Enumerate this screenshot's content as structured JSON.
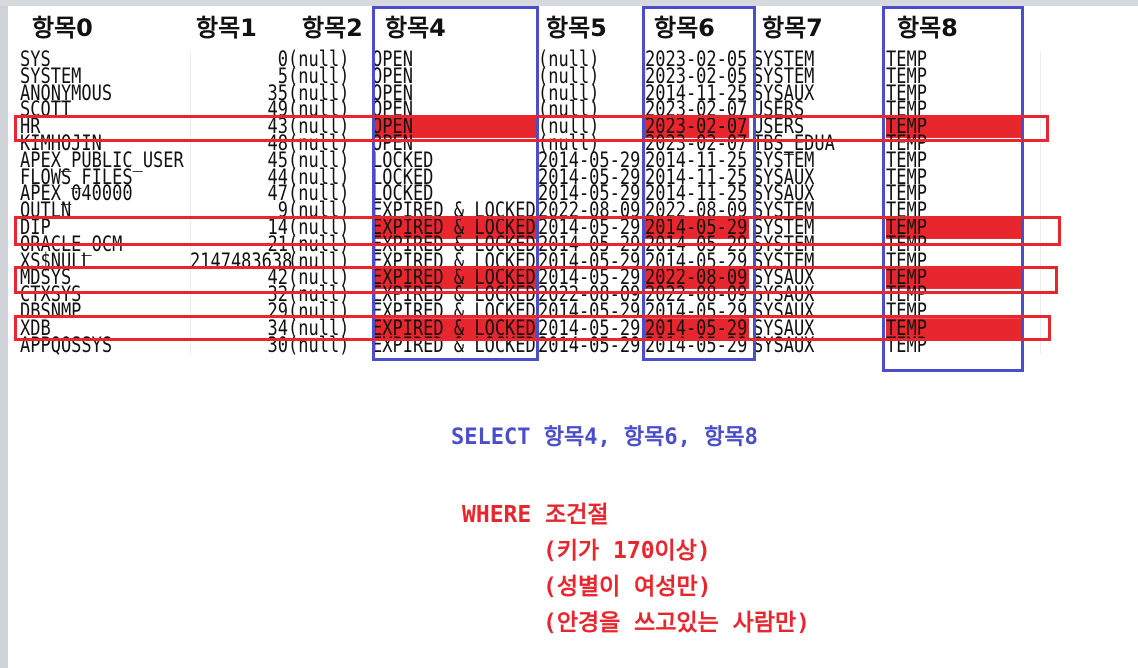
{
  "headers": [
    "항목0",
    "항목1",
    "항목2",
    "항목4",
    "항목5",
    "항목6",
    "항목7",
    "항목8"
  ],
  "table": {
    "rows": [
      {
        "username": "SYS",
        "id": "0",
        "col2": "(null)",
        "status": "OPEN",
        "col5": "(null)",
        "created": "2023-02-05",
        "tablespace": "SYSTEM",
        "temp": "TEMP",
        "highlight": false
      },
      {
        "username": "SYSTEM",
        "id": "5",
        "col2": "(null)",
        "status": "OPEN",
        "col5": "(null)",
        "created": "2023-02-05",
        "tablespace": "SYSTEM",
        "temp": "TEMP",
        "highlight": false
      },
      {
        "username": "ANONYMOUS",
        "id": "35",
        "col2": "(null)",
        "status": "OPEN",
        "col5": "(null)",
        "created": "2014-11-25",
        "tablespace": "SYSAUX",
        "temp": "TEMP",
        "highlight": false
      },
      {
        "username": "SCOTT",
        "id": "49",
        "col2": "(null)",
        "status": "OPEN",
        "col5": "(null)",
        "created": "2023-02-07",
        "tablespace": "USERS",
        "temp": "TEMP",
        "highlight": false
      },
      {
        "username": "HR",
        "id": "43",
        "col2": "(null)",
        "status": "OPEN",
        "col5": "(null)",
        "created": "2023-02-07",
        "tablespace": "USERS",
        "temp": "TEMP",
        "highlight": true
      },
      {
        "username": "KIMHOJIN",
        "id": "48",
        "col2": "(null)",
        "status": "OPEN",
        "col5": "(null)",
        "created": "2023-02-07",
        "tablespace": "TBS_EDUA",
        "temp": "TEMP",
        "highlight": false
      },
      {
        "username": "APEX_PUBLIC_USER",
        "id": "45",
        "col2": "(null)",
        "status": "LOCKED",
        "col5": "2014-05-29",
        "created": "2014-11-25",
        "tablespace": "SYSTEM",
        "temp": "TEMP",
        "highlight": false
      },
      {
        "username": "FLOWS_FILES",
        "id": "44",
        "col2": "(null)",
        "status": "LOCKED",
        "col5": "2014-05-29",
        "created": "2014-11-25",
        "tablespace": "SYSAUX",
        "temp": "TEMP",
        "highlight": false
      },
      {
        "username": "APEX_040000",
        "id": "47",
        "col2": "(null)",
        "status": "LOCKED",
        "col5": "2014-05-29",
        "created": "2014-11-25",
        "tablespace": "SYSAUX",
        "temp": "TEMP",
        "highlight": false
      },
      {
        "username": "OUTLN",
        "id": "9",
        "col2": "(null)",
        "status": "EXPIRED & LOCKED",
        "col5": "2022-08-09",
        "created": "2022-08-09",
        "tablespace": "SYSTEM",
        "temp": "TEMP",
        "highlight": false
      },
      {
        "username": "DIP",
        "id": "14",
        "col2": "(null)",
        "status": "EXPIRED & LOCKED",
        "col5": "2014-05-29",
        "created": "2014-05-29",
        "tablespace": "SYSTEM",
        "temp": "TEMP",
        "highlight": true
      },
      {
        "username": "ORACLE_OCM",
        "id": "21",
        "col2": "(null)",
        "status": "EXPIRED & LOCKED",
        "col5": "2014-05-29",
        "created": "2014-05-29",
        "tablespace": "SYSTEM",
        "temp": "TEMP",
        "highlight": false
      },
      {
        "username": "XS$NULL",
        "id": "2147483638",
        "col2": "(null)",
        "status": "EXPIRED & LOCKED",
        "col5": "2014-05-29",
        "created": "2014-05-29",
        "tablespace": "SYSTEM",
        "temp": "TEMP",
        "highlight": false
      },
      {
        "username": "MDSYS",
        "id": "42",
        "col2": "(null)",
        "status": "EXPIRED & LOCKED",
        "col5": "2014-05-29",
        "created": "2022-08-09",
        "tablespace": "SYSAUX",
        "temp": "TEMP",
        "highlight": true
      },
      {
        "username": "CTXSYS",
        "id": "32",
        "col2": "(null)",
        "status": "EXPIRED & LOCKED",
        "col5": "2022-08-09",
        "created": "2022-08-09",
        "tablespace": "SYSAUX",
        "temp": "TEMP",
        "highlight": false
      },
      {
        "username": "DBSNMP",
        "id": "29",
        "col2": "(null)",
        "status": "EXPIRED & LOCKED",
        "col5": "2014-05-29",
        "created": "2014-05-29",
        "tablespace": "SYSAUX",
        "temp": "TEMP",
        "highlight": false
      },
      {
        "username": "XDB",
        "id": "34",
        "col2": "(null)",
        "status": "EXPIRED & LOCKED",
        "col5": "2014-05-29",
        "created": "2014-05-29",
        "tablespace": "SYSAUX",
        "temp": "TEMP",
        "highlight": true
      },
      {
        "username": "APPQOSSYS",
        "id": "30",
        "col2": "(null)",
        "status": "EXPIRED & LOCKED",
        "col5": "2014-05-29",
        "created": "2014-05-29",
        "tablespace": "SYSAUX",
        "temp": "TEMP",
        "highlight": false
      }
    ]
  },
  "annotations": {
    "select_clause": "SELECT 항목4, 항목6, 항목8",
    "where_clause": "WHERE 조건절",
    "conditions": [
      "(키가 170이상)",
      "(성별이 여성만)",
      "(안경을 쓰고있는 사람만)"
    ]
  },
  "colors": {
    "select_box": "#4a4fc9",
    "where_box": "#e8262d",
    "highlight_fill": "#e8262d",
    "text": "#111111"
  }
}
